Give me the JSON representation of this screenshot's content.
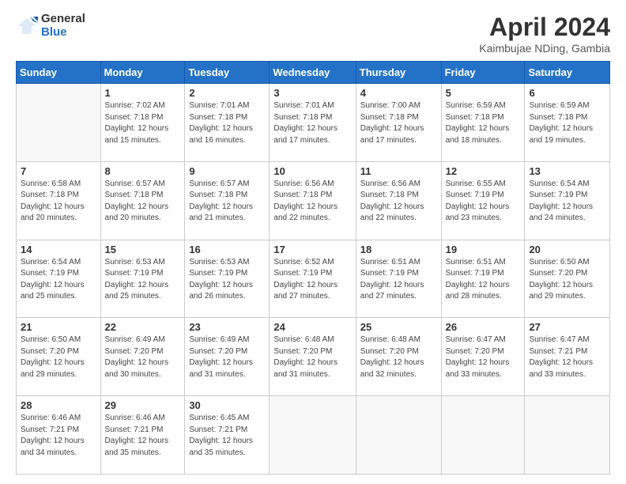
{
  "header": {
    "logo_line1": "General",
    "logo_line2": "Blue",
    "month": "April 2024",
    "location": "Kaimbujae NDing, Gambia"
  },
  "weekdays": [
    "Sunday",
    "Monday",
    "Tuesday",
    "Wednesday",
    "Thursday",
    "Friday",
    "Saturday"
  ],
  "weeks": [
    [
      {
        "day": null
      },
      {
        "day": "1",
        "sunrise": "Sunrise: 7:02 AM",
        "sunset": "Sunset: 7:18 PM",
        "daylight": "Daylight: 12 hours and 15 minutes."
      },
      {
        "day": "2",
        "sunrise": "Sunrise: 7:01 AM",
        "sunset": "Sunset: 7:18 PM",
        "daylight": "Daylight: 12 hours and 16 minutes."
      },
      {
        "day": "3",
        "sunrise": "Sunrise: 7:01 AM",
        "sunset": "Sunset: 7:18 PM",
        "daylight": "Daylight: 12 hours and 17 minutes."
      },
      {
        "day": "4",
        "sunrise": "Sunrise: 7:00 AM",
        "sunset": "Sunset: 7:18 PM",
        "daylight": "Daylight: 12 hours and 17 minutes."
      },
      {
        "day": "5",
        "sunrise": "Sunrise: 6:59 AM",
        "sunset": "Sunset: 7:18 PM",
        "daylight": "Daylight: 12 hours and 18 minutes."
      },
      {
        "day": "6",
        "sunrise": "Sunrise: 6:59 AM",
        "sunset": "Sunset: 7:18 PM",
        "daylight": "Daylight: 12 hours and 19 minutes."
      }
    ],
    [
      {
        "day": "7",
        "sunrise": "Sunrise: 6:58 AM",
        "sunset": "Sunset: 7:18 PM",
        "daylight": "Daylight: 12 hours and 20 minutes."
      },
      {
        "day": "8",
        "sunrise": "Sunrise: 6:57 AM",
        "sunset": "Sunset: 7:18 PM",
        "daylight": "Daylight: 12 hours and 20 minutes."
      },
      {
        "day": "9",
        "sunrise": "Sunrise: 6:57 AM",
        "sunset": "Sunset: 7:18 PM",
        "daylight": "Daylight: 12 hours and 21 minutes."
      },
      {
        "day": "10",
        "sunrise": "Sunrise: 6:56 AM",
        "sunset": "Sunset: 7:18 PM",
        "daylight": "Daylight: 12 hours and 22 minutes."
      },
      {
        "day": "11",
        "sunrise": "Sunrise: 6:56 AM",
        "sunset": "Sunset: 7:18 PM",
        "daylight": "Daylight: 12 hours and 22 minutes."
      },
      {
        "day": "12",
        "sunrise": "Sunrise: 6:55 AM",
        "sunset": "Sunset: 7:19 PM",
        "daylight": "Daylight: 12 hours and 23 minutes."
      },
      {
        "day": "13",
        "sunrise": "Sunrise: 6:54 AM",
        "sunset": "Sunset: 7:19 PM",
        "daylight": "Daylight: 12 hours and 24 minutes."
      }
    ],
    [
      {
        "day": "14",
        "sunrise": "Sunrise: 6:54 AM",
        "sunset": "Sunset: 7:19 PM",
        "daylight": "Daylight: 12 hours and 25 minutes."
      },
      {
        "day": "15",
        "sunrise": "Sunrise: 6:53 AM",
        "sunset": "Sunset: 7:19 PM",
        "daylight": "Daylight: 12 hours and 25 minutes."
      },
      {
        "day": "16",
        "sunrise": "Sunrise: 6:53 AM",
        "sunset": "Sunset: 7:19 PM",
        "daylight": "Daylight: 12 hours and 26 minutes."
      },
      {
        "day": "17",
        "sunrise": "Sunrise: 6:52 AM",
        "sunset": "Sunset: 7:19 PM",
        "daylight": "Daylight: 12 hours and 27 minutes."
      },
      {
        "day": "18",
        "sunrise": "Sunrise: 6:51 AM",
        "sunset": "Sunset: 7:19 PM",
        "daylight": "Daylight: 12 hours and 27 minutes."
      },
      {
        "day": "19",
        "sunrise": "Sunrise: 6:51 AM",
        "sunset": "Sunset: 7:19 PM",
        "daylight": "Daylight: 12 hours and 28 minutes."
      },
      {
        "day": "20",
        "sunrise": "Sunrise: 6:50 AM",
        "sunset": "Sunset: 7:20 PM",
        "daylight": "Daylight: 12 hours and 29 minutes."
      }
    ],
    [
      {
        "day": "21",
        "sunrise": "Sunrise: 6:50 AM",
        "sunset": "Sunset: 7:20 PM",
        "daylight": "Daylight: 12 hours and 29 minutes."
      },
      {
        "day": "22",
        "sunrise": "Sunrise: 6:49 AM",
        "sunset": "Sunset: 7:20 PM",
        "daylight": "Daylight: 12 hours and 30 minutes."
      },
      {
        "day": "23",
        "sunrise": "Sunrise: 6:49 AM",
        "sunset": "Sunset: 7:20 PM",
        "daylight": "Daylight: 12 hours and 31 minutes."
      },
      {
        "day": "24",
        "sunrise": "Sunrise: 6:48 AM",
        "sunset": "Sunset: 7:20 PM",
        "daylight": "Daylight: 12 hours and 31 minutes."
      },
      {
        "day": "25",
        "sunrise": "Sunrise: 6:48 AM",
        "sunset": "Sunset: 7:20 PM",
        "daylight": "Daylight: 12 hours and 32 minutes."
      },
      {
        "day": "26",
        "sunrise": "Sunrise: 6:47 AM",
        "sunset": "Sunset: 7:20 PM",
        "daylight": "Daylight: 12 hours and 33 minutes."
      },
      {
        "day": "27",
        "sunrise": "Sunrise: 6:47 AM",
        "sunset": "Sunset: 7:21 PM",
        "daylight": "Daylight: 12 hours and 33 minutes."
      }
    ],
    [
      {
        "day": "28",
        "sunrise": "Sunrise: 6:46 AM",
        "sunset": "Sunset: 7:21 PM",
        "daylight": "Daylight: 12 hours and 34 minutes."
      },
      {
        "day": "29",
        "sunrise": "Sunrise: 6:46 AM",
        "sunset": "Sunset: 7:21 PM",
        "daylight": "Daylight: 12 hours and 35 minutes."
      },
      {
        "day": "30",
        "sunrise": "Sunrise: 6:45 AM",
        "sunset": "Sunset: 7:21 PM",
        "daylight": "Daylight: 12 hours and 35 minutes."
      },
      {
        "day": null
      },
      {
        "day": null
      },
      {
        "day": null
      },
      {
        "day": null
      }
    ]
  ]
}
